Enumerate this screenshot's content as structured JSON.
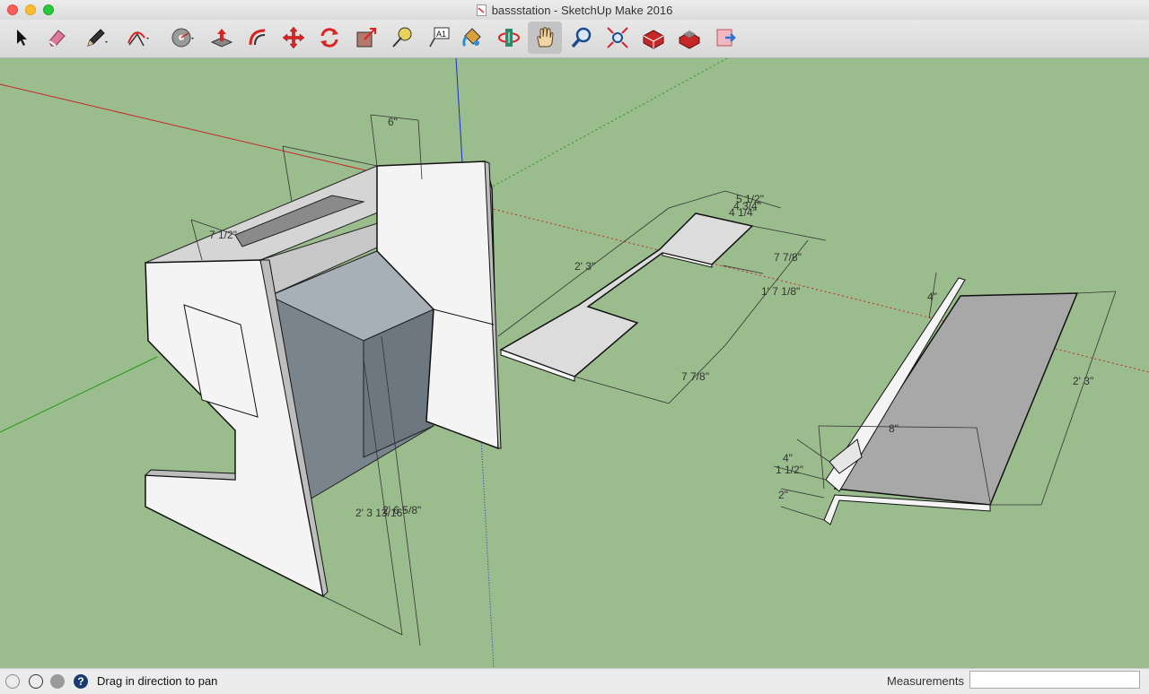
{
  "window": {
    "title": "bassstation - SketchUp Make 2016"
  },
  "toolbar": {
    "tools": [
      {
        "name": "select-tool",
        "icon": "arrow-cursor-icon"
      },
      {
        "name": "eraser-tool",
        "icon": "eraser-icon"
      },
      {
        "name": "line-tool",
        "icon": "pencil-icon",
        "has_dropdown": true
      },
      {
        "name": "arc-tool",
        "icon": "arc-icon",
        "has_dropdown": true
      },
      {
        "name": "shapes-tool",
        "icon": "circle-shape-icon",
        "has_dropdown": true
      },
      {
        "name": "push-pull-tool",
        "icon": "push-pull-icon"
      },
      {
        "name": "offset-tool",
        "icon": "offset-icon"
      },
      {
        "name": "move-tool",
        "icon": "move-arrows-icon"
      },
      {
        "name": "rotate-tool",
        "icon": "rotate-icon"
      },
      {
        "name": "scale-tool",
        "icon": "scale-icon"
      },
      {
        "name": "tape-measure-tool",
        "icon": "tape-measure-icon"
      },
      {
        "name": "text-tool",
        "icon": "text-label-icon",
        "label": "A1"
      },
      {
        "name": "paint-bucket-tool",
        "icon": "paint-bucket-icon"
      },
      {
        "name": "orbit-tool",
        "icon": "orbit-icon"
      },
      {
        "name": "pan-tool",
        "icon": "hand-icon",
        "active": true
      },
      {
        "name": "zoom-tool",
        "icon": "magnifier-icon"
      },
      {
        "name": "zoom-extents-tool",
        "icon": "zoom-extents-icon"
      },
      {
        "name": "warehouse-tool",
        "icon": "3d-warehouse-icon"
      },
      {
        "name": "extension-warehouse-tool",
        "icon": "extension-warehouse-icon"
      },
      {
        "name": "share-model-tool",
        "icon": "share-model-icon"
      }
    ]
  },
  "model": {
    "dimensions": {
      "d1": "6\"",
      "d2": "7 1/2\"",
      "d3": "5 1/2\"",
      "d4": "4 3/4\"",
      "d5": "4 1/4\"",
      "d6": "2' 3\"",
      "d7": "7 7/8\"",
      "d8": "1' 7 1/8\"",
      "d9": "7 7/8\"",
      "d10": "2' 3 13/16\"",
      "d11": "2' 6 5/8\"",
      "d12": "4\"",
      "d13": "2' 3\"",
      "d14": "8\"",
      "d15": "4\"",
      "d16": "1 1/2\"",
      "d17": "2\""
    },
    "colors": {
      "background": "#9bbc8d",
      "red_axis": "#c62828",
      "green_axis": "#2e9e2e",
      "blue_axis": "#2233cc"
    }
  },
  "statusbar": {
    "hint": "Drag in direction to pan",
    "measurements_label": "Measurements",
    "measurements_value": ""
  }
}
